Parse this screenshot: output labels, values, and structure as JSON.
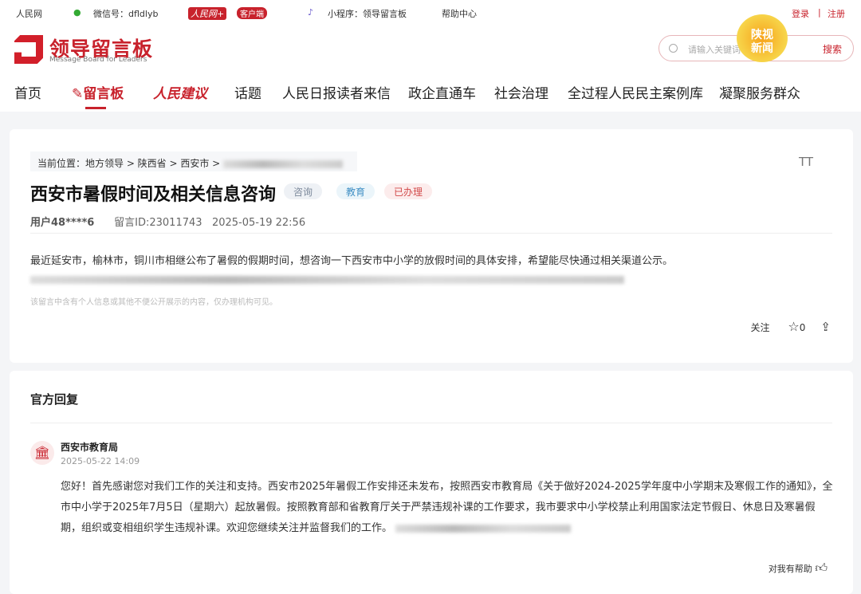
{
  "topbar": {
    "site": "人民网",
    "wechat": "微信号：dfldlyb",
    "app_logo": "人民网+",
    "app_badge": "客户端",
    "miniprogram": "小程序：领导留言板",
    "help": "帮助中心",
    "login": "登录",
    "sep": "|",
    "register": "注册"
  },
  "logo": {
    "name": "领导留言板",
    "subtitle": "Message Board for Leaders"
  },
  "search": {
    "placeholder": "请输入关键词",
    "button": "搜索"
  },
  "watermark": "陕视新闻",
  "nav": [
    "首页",
    "留言板",
    "人民建议",
    "话题",
    "人民日报读者来信",
    "政企直通车",
    "社会治理",
    "全过程人民民主案例库",
    "凝聚服务群众"
  ],
  "message": {
    "breadcrumb": "当前位置：地方领导 > 陕西省 > 西安市 >",
    "title": "西安市暑假时间及相关信息咨询",
    "tags": [
      {
        "label": "咨询",
        "color": "#7d8a9c"
      },
      {
        "label": "教育",
        "color": "#3f8fc4"
      },
      {
        "label": "已办理",
        "color": "#d24a4a"
      }
    ],
    "user": "用户48****6",
    "id": "留言ID:23011743",
    "date": "2025-05-19 22:56",
    "body": "最近延安市，榆林市，铜川市相继公布了暑假的假期时间，想咨询一下西安市中小学的放假时间的具体安排，希望能尽快通过相关渠道公示。",
    "note": "该留言中含有个人信息或其他不便公开展示的内容，仅办理机构可见。",
    "font_toggle": "TT",
    "follow": "关注",
    "stars": "0"
  },
  "reply": {
    "section": "官方回复",
    "org": "西安市教育局",
    "date": "2025-05-22 14:09",
    "body": "您好！首先感谢您对我们工作的关注和支持。西安市2025年暑假工作安排还未发布，按照西安市教育局《关于做好2024-2025学年度中小学期末及寒假工作的通知》，全市中小学于2025年7月5日（星期六）起放暑假。按照教育部和省教育厅关于严禁违规补课的工作要求，我市要求中小学校禁止利用国家法定节假日、休息日及寒暑假期，组织或变相组织学生违规补课。欢迎您继续关注并监督我们的工作。",
    "helpful": "对我有帮助"
  }
}
